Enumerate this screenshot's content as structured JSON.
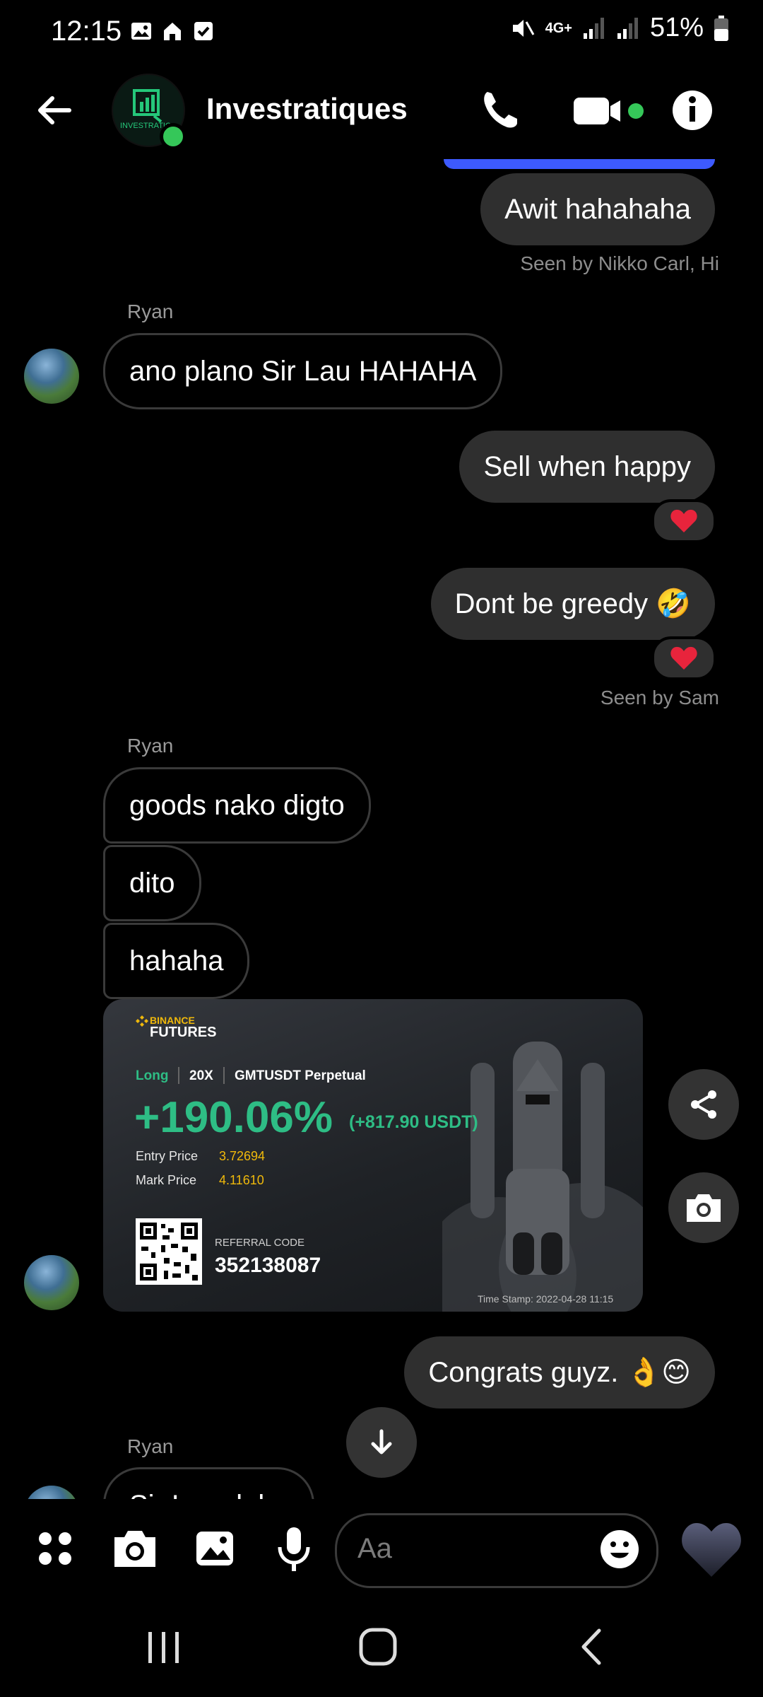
{
  "status_bar": {
    "time": "12:15",
    "battery": "51%",
    "network": "4G+"
  },
  "header": {
    "title": "Investratiques",
    "avatar_caption": "INVESTRATIQ"
  },
  "messages": {
    "m1": "Awit hahahaha",
    "seen1": "Seen by Nikko Carl, Hi",
    "sender1": "Ryan",
    "m2": "ano plano Sir Lau HAHAHA",
    "m3": "Sell when happy",
    "m4": "Dont be greedy 🤣",
    "seen2": "Seen by Sam",
    "sender2": "Ryan",
    "m5": "goods nako digto",
    "m6": "dito",
    "m7": "hahaha",
    "m8": "Congrats guyz. 👌😊",
    "sender3": "Ryan",
    "m9_partial": "Sir Lau dal..."
  },
  "card": {
    "brand_top": "BINANCE",
    "brand_bottom": "FUTURES",
    "side": "Long",
    "leverage": "20X",
    "pair": "GMTUSDT Perpetual",
    "pnl_pct": "+190.06%",
    "pnl_usdt": "(+817.90 USDT)",
    "entry_label": "Entry Price",
    "entry_value": "3.72694",
    "mark_label": "Mark Price",
    "mark_value": "4.11610",
    "referral_label": "REFERRAL CODE",
    "referral_code": "352138087",
    "timestamp": "Time Stamp: 2022-04-28 11:15"
  },
  "composer": {
    "placeholder": "Aa"
  },
  "colors": {
    "accent_blue": "#3d5afe",
    "online": "#35c759",
    "binance_green": "#2ebd85",
    "binance_yellow": "#f0b90b",
    "heart": "#e8243c"
  }
}
